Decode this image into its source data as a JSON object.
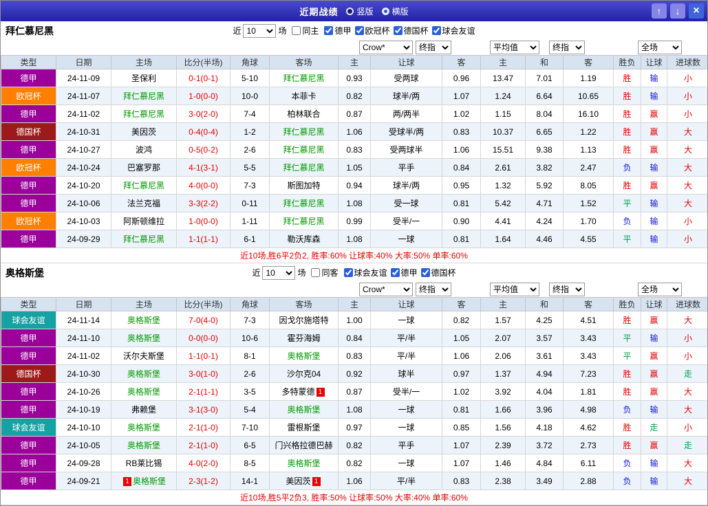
{
  "titlebar": {
    "title": "近期战绩",
    "vertical_label": "竖版",
    "horizontal_label": "横版",
    "selected_layout": "横版",
    "icons": {
      "up": "↑",
      "down": "↓",
      "close": "×"
    }
  },
  "columns": [
    "类型",
    "日期",
    "主场",
    "比分(半场)",
    "角球",
    "客场",
    "主",
    "让球",
    "客",
    "主",
    "和",
    "客",
    "胜负",
    "让球",
    "进球数"
  ],
  "league_colors": {
    "德甲": "#9b009b",
    "欧冠杯": "#ff7f00",
    "德国杯": "#9e1a1a",
    "球会友谊": "#16a2a2"
  },
  "result_colors": {
    "胜": "#e60000",
    "平": "#00a050",
    "负": "#1515d0",
    "赢": "#e60000",
    "输": "#1515d0",
    "走": "#00a050",
    "大": "#e60000",
    "小": "#e60000"
  },
  "sections": [
    {
      "team": "拜仁慕尼黑",
      "filter": {
        "near_label": "近",
        "count": "10",
        "matches_label": "场",
        "same_label": "同主",
        "leagues": [
          "德甲",
          "欧冠杯",
          "德国杯",
          "球会友谊"
        ]
      },
      "selects": {
        "company": "Crow*",
        "final1": "终指",
        "average": "平均值",
        "final2": "终指",
        "scope": "全场"
      },
      "rows": [
        {
          "league": "德甲",
          "date": "24-11-09",
          "home": "圣保利",
          "home_self": false,
          "score": "0-1(0-1)",
          "corner": "5-10",
          "away": "拜仁慕尼黑",
          "away_self": true,
          "odds": [
            "0.93",
            "受两球",
            "0.96"
          ],
          "avg": [
            "13.47",
            "7.01",
            "1.19"
          ],
          "res": [
            "胜",
            "输",
            "小"
          ]
        },
        {
          "league": "欧冠杯",
          "date": "24-11-07",
          "home": "拜仁慕尼黑",
          "home_self": true,
          "score": "1-0(0-0)",
          "corner": "10-0",
          "away": "本菲卡",
          "away_self": false,
          "odds": [
            "0.82",
            "球半/两",
            "1.07"
          ],
          "avg": [
            "1.24",
            "6.64",
            "10.65"
          ],
          "res": [
            "胜",
            "输",
            "小"
          ]
        },
        {
          "league": "德甲",
          "date": "24-11-02",
          "home": "拜仁慕尼黑",
          "home_self": true,
          "score": "3-0(2-0)",
          "corner": "7-4",
          "away": "柏林联合",
          "away_self": false,
          "odds": [
            "0.87",
            "两/两半",
            "1.02"
          ],
          "avg": [
            "1.15",
            "8.04",
            "16.10"
          ],
          "res": [
            "胜",
            "赢",
            "小"
          ]
        },
        {
          "league": "德国杯",
          "date": "24-10-31",
          "home": "美因茨",
          "home_self": false,
          "score": "0-4(0-4)",
          "corner": "1-2",
          "away": "拜仁慕尼黑",
          "away_self": true,
          "odds": [
            "1.06",
            "受球半/两",
            "0.83"
          ],
          "avg": [
            "10.37",
            "6.65",
            "1.22"
          ],
          "res": [
            "胜",
            "赢",
            "大"
          ]
        },
        {
          "league": "德甲",
          "date": "24-10-27",
          "home": "波鸿",
          "home_self": false,
          "score": "0-5(0-2)",
          "corner": "2-6",
          "away": "拜仁慕尼黑",
          "away_self": true,
          "odds": [
            "0.83",
            "受两球半",
            "1.06"
          ],
          "avg": [
            "15.51",
            "9.38",
            "1.13"
          ],
          "res": [
            "胜",
            "赢",
            "大"
          ]
        },
        {
          "league": "欧冠杯",
          "date": "24-10-24",
          "home": "巴塞罗那",
          "home_self": false,
          "score": "4-1(3-1)",
          "corner": "5-5",
          "away": "拜仁慕尼黑",
          "away_self": true,
          "odds": [
            "1.05",
            "平手",
            "0.84"
          ],
          "avg": [
            "2.61",
            "3.82",
            "2.47"
          ],
          "res": [
            "负",
            "输",
            "大"
          ]
        },
        {
          "league": "德甲",
          "date": "24-10-20",
          "home": "拜仁慕尼黑",
          "home_self": true,
          "score": "4-0(0-0)",
          "corner": "7-3",
          "away": "斯图加特",
          "away_self": false,
          "odds": [
            "0.94",
            "球半/两",
            "0.95"
          ],
          "avg": [
            "1.32",
            "5.92",
            "8.05"
          ],
          "res": [
            "胜",
            "赢",
            "大"
          ]
        },
        {
          "league": "德甲",
          "date": "24-10-06",
          "home": "法兰克福",
          "home_self": false,
          "score": "3-3(2-2)",
          "corner": "0-11",
          "away": "拜仁慕尼黑",
          "away_self": true,
          "odds": [
            "1.08",
            "受一球",
            "0.81"
          ],
          "avg": [
            "5.42",
            "4.71",
            "1.52"
          ],
          "res": [
            "平",
            "输",
            "大"
          ]
        },
        {
          "league": "欧冠杯",
          "date": "24-10-03",
          "home": "阿斯顿维拉",
          "home_self": false,
          "score": "1-0(0-0)",
          "corner": "1-11",
          "away": "拜仁慕尼黑",
          "away_self": true,
          "odds": [
            "0.99",
            "受半/一",
            "0.90"
          ],
          "avg": [
            "4.41",
            "4.24",
            "1.70"
          ],
          "res": [
            "负",
            "输",
            "小"
          ]
        },
        {
          "league": "德甲",
          "date": "24-09-29",
          "home": "拜仁慕尼黑",
          "home_self": true,
          "score": "1-1(1-1)",
          "corner": "6-1",
          "away": "勒沃库森",
          "away_self": false,
          "odds": [
            "1.08",
            "一球",
            "0.81"
          ],
          "avg": [
            "1.64",
            "4.46",
            "4.55"
          ],
          "res": [
            "平",
            "输",
            "小"
          ]
        }
      ],
      "summary": "近10场,胜6平2负2, 胜率:60% 让球率:40% 大率:50% 单率:60%"
    },
    {
      "team": "奥格斯堡",
      "filter": {
        "near_label": "近",
        "count": "10",
        "matches_label": "场",
        "same_label": "同客",
        "leagues": [
          "球会友谊",
          "德甲",
          "德国杯"
        ]
      },
      "selects": {
        "company": "Crow*",
        "final1": "终指",
        "average": "平均值",
        "final2": "终指",
        "scope": "全场"
      },
      "rows": [
        {
          "league": "球会友谊",
          "date": "24-11-14",
          "home": "奥格斯堡",
          "home_self": true,
          "score": "7-0(4-0)",
          "corner": "7-3",
          "away": "因戈尔施塔特",
          "away_self": false,
          "odds": [
            "1.00",
            "一球",
            "0.82"
          ],
          "avg": [
            "1.57",
            "4.25",
            "4.51"
          ],
          "res": [
            "胜",
            "赢",
            "大"
          ]
        },
        {
          "league": "德甲",
          "date": "24-11-10",
          "home": "奥格斯堡",
          "home_self": true,
          "score": "0-0(0-0)",
          "corner": "10-6",
          "away": "霍芬海姆",
          "away_self": false,
          "odds": [
            "0.84",
            "平/半",
            "1.05"
          ],
          "avg": [
            "2.07",
            "3.57",
            "3.43"
          ],
          "res": [
            "平",
            "输",
            "小"
          ]
        },
        {
          "league": "德甲",
          "date": "24-11-02",
          "home": "沃尔夫斯堡",
          "home_self": false,
          "score": "1-1(0-1)",
          "corner": "8-1",
          "away": "奥格斯堡",
          "away_self": true,
          "odds": [
            "0.83",
            "平/半",
            "1.06"
          ],
          "avg": [
            "2.06",
            "3.61",
            "3.43"
          ],
          "res": [
            "平",
            "赢",
            "小"
          ]
        },
        {
          "league": "德国杯",
          "date": "24-10-30",
          "home": "奥格斯堡",
          "home_self": true,
          "score": "3-0(1-0)",
          "corner": "2-6",
          "away": "沙尔克04",
          "away_self": false,
          "odds": [
            "0.92",
            "球半",
            "0.97"
          ],
          "avg": [
            "1.37",
            "4.94",
            "7.23"
          ],
          "res": [
            "胜",
            "赢",
            "走"
          ]
        },
        {
          "league": "德甲",
          "date": "24-10-26",
          "home": "奥格斯堡",
          "home_self": true,
          "score": "2-1(1-1)",
          "corner": "3-5",
          "away": "多特蒙德",
          "away_self": false,
          "away_badge": "1",
          "odds": [
            "0.87",
            "受半/一",
            "1.02"
          ],
          "avg": [
            "3.92",
            "4.04",
            "1.81"
          ],
          "res": [
            "胜",
            "赢",
            "大"
          ]
        },
        {
          "league": "德甲",
          "date": "24-10-19",
          "home": "弗赖堡",
          "home_self": false,
          "score": "3-1(3-0)",
          "corner": "5-4",
          "away": "奥格斯堡",
          "away_self": true,
          "odds": [
            "1.08",
            "一球",
            "0.81"
          ],
          "avg": [
            "1.66",
            "3.96",
            "4.98"
          ],
          "res": [
            "负",
            "输",
            "大"
          ]
        },
        {
          "league": "球会友谊",
          "date": "24-10-10",
          "home": "奥格斯堡",
          "home_self": true,
          "score": "2-1(1-0)",
          "corner": "7-10",
          "away": "雷根斯堡",
          "away_self": false,
          "odds": [
            "0.97",
            "一球",
            "0.85"
          ],
          "avg": [
            "1.56",
            "4.18",
            "4.62"
          ],
          "res": [
            "胜",
            "走",
            "小"
          ]
        },
        {
          "league": "德甲",
          "date": "24-10-05",
          "home": "奥格斯堡",
          "home_self": true,
          "score": "2-1(1-0)",
          "corner": "6-5",
          "away": "门兴格拉德巴赫",
          "away_self": false,
          "odds": [
            "0.82",
            "平手",
            "1.07"
          ],
          "avg": [
            "2.39",
            "3.72",
            "2.73"
          ],
          "res": [
            "胜",
            "赢",
            "走"
          ]
        },
        {
          "league": "德甲",
          "date": "24-09-28",
          "home": "RB莱比锡",
          "home_self": false,
          "score": "4-0(2-0)",
          "corner": "8-5",
          "away": "奥格斯堡",
          "away_self": true,
          "odds": [
            "0.82",
            "一球",
            "1.07"
          ],
          "avg": [
            "1.46",
            "4.84",
            "6.11"
          ],
          "res": [
            "负",
            "输",
            "大"
          ]
        },
        {
          "league": "德甲",
          "date": "24-09-21",
          "home": "奥格斯堡",
          "home_self": true,
          "home_badge_pre": "1",
          "score": "2-3(1-2)",
          "corner": "14-1",
          "away": "美因茨",
          "away_self": false,
          "away_badge": "1",
          "odds": [
            "1.06",
            "平/半",
            "0.83"
          ],
          "avg": [
            "2.38",
            "3.49",
            "2.88"
          ],
          "res": [
            "负",
            "输",
            "大"
          ]
        }
      ],
      "summary": "近10场,胜5平2负3, 胜率:50% 让球率:50% 大率:40% 单率:60%"
    }
  ]
}
